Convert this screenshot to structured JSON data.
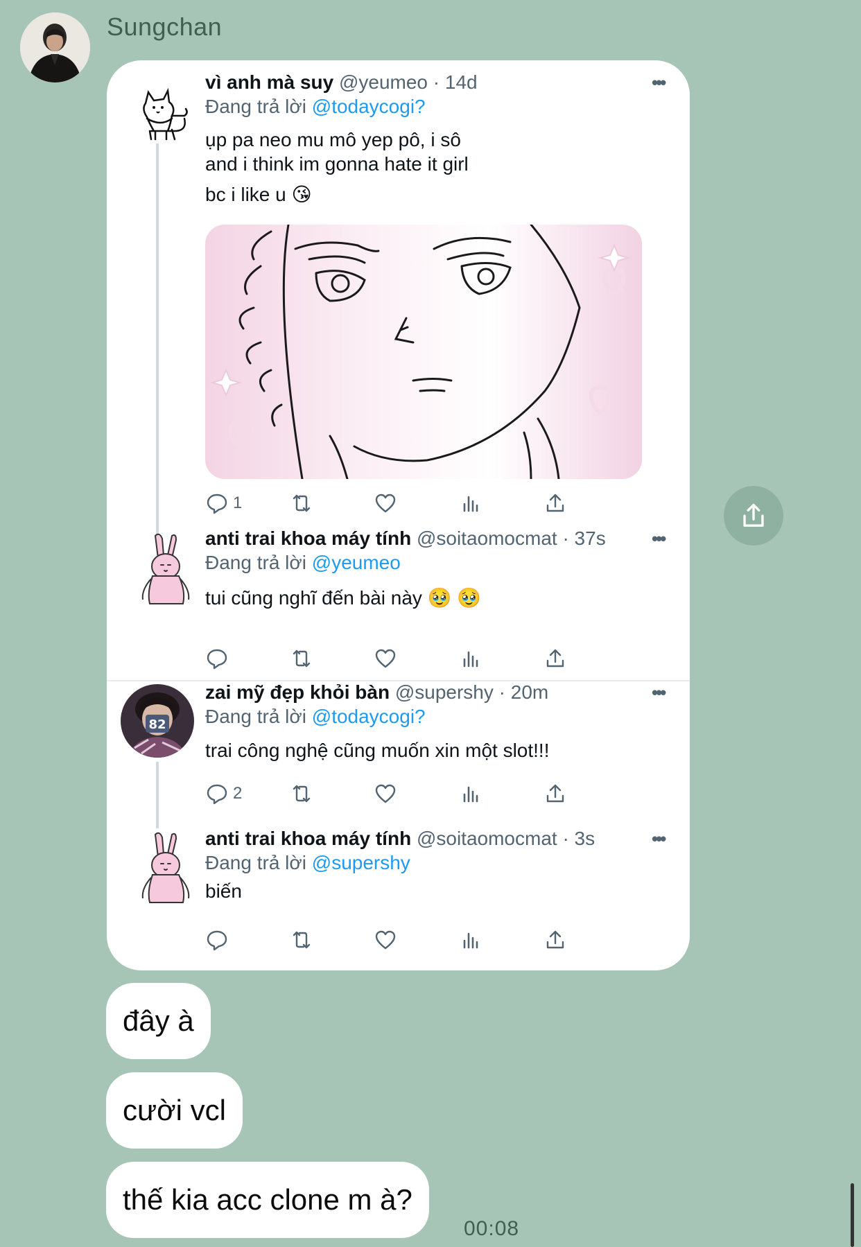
{
  "chat": {
    "sender_name": "Sungchan",
    "timestamp": "00:08"
  },
  "embed": {
    "tweets": [
      {
        "name": "vì anh mà suy",
        "handle_time": "@yeumeo · 14d",
        "reply_prefix": "Đang trả lời",
        "reply_to": "@todaycogi?",
        "lines": [
          "ụp pa neo mu mô yep pô, i sô",
          "and i think im gonna hate it girl",
          "bc i like u 😘"
        ],
        "reply_count": "1",
        "avatar": "cat-doodle-avatar"
      },
      {
        "name": "anti trai khoa máy tính",
        "handle_time": "@soitaomocmat · 37s",
        "reply_prefix": "Đang trả lời",
        "reply_to": "@yeumeo",
        "lines": [
          "tui cũng nghĩ đến bài này 🥹 🥹"
        ],
        "reply_count": "",
        "avatar": "pink-rabbit-avatar"
      },
      {
        "name": "zai mỹ đẹp khỏi bàn",
        "handle_time": "@supershy · 20m",
        "reply_prefix": "Đang trả lời",
        "reply_to": "@todaycogi?",
        "lines": [
          "trai công nghệ cũng muốn xin một slot!!!"
        ],
        "reply_count": "2",
        "avatar": "person-photo-avatar"
      },
      {
        "name": "anti trai khoa máy tính",
        "handle_time": "@soitaomocmat · 3s",
        "reply_prefix": "Đang trả lời",
        "reply_to": "@supershy",
        "lines": [
          "biến"
        ],
        "reply_count": "",
        "avatar": "pink-rabbit-avatar"
      }
    ],
    "more_label": "•••"
  },
  "messages": [
    "đây à",
    "cười vcl",
    "thế kia acc clone m à?"
  ],
  "colors": {
    "chat_background": "#a7c5b6",
    "mention": "#1d9bf0",
    "icon_gray": "#536471"
  }
}
